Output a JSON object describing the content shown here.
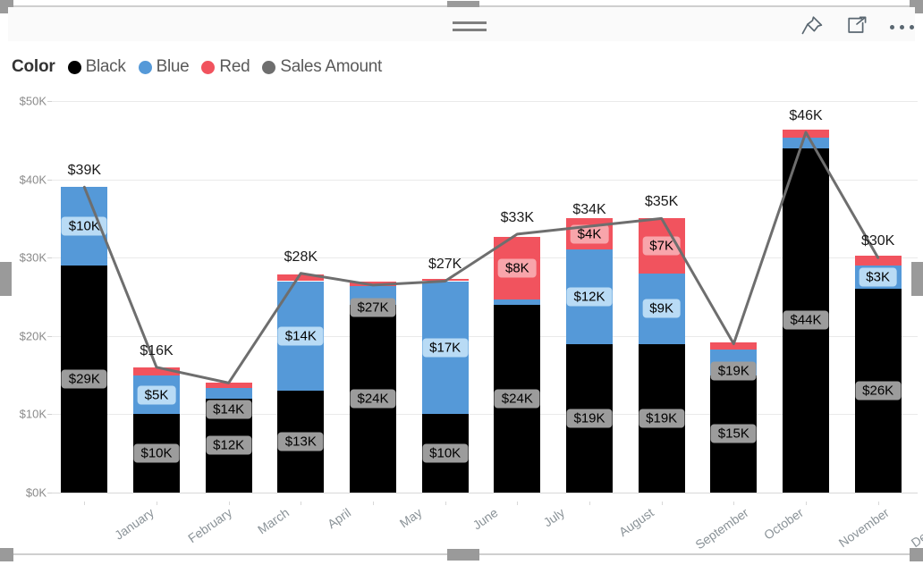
{
  "header": {
    "drag_handle_name": "drag-handle",
    "icons": [
      {
        "name": "pin-icon",
        "label": "Pin to dashboard"
      },
      {
        "name": "focus-icon",
        "label": "Focus mode"
      },
      {
        "name": "more-icon",
        "label": "More options"
      }
    ]
  },
  "legend": {
    "title": "Color",
    "items": [
      {
        "label": "Black",
        "color": "#000000"
      },
      {
        "label": "Blue",
        "color": "#5599d8"
      },
      {
        "label": "Red",
        "color": "#f1535e"
      },
      {
        "label": "Sales Amount",
        "color": "#6e6e6e"
      }
    ]
  },
  "chart_data": {
    "type": "bar",
    "subtype": "stacked-column-with-line",
    "title": "",
    "xlabel": "",
    "ylabel": "",
    "ylim": [
      0,
      50000
    ],
    "grid": true,
    "legend_position": "top",
    "y_ticks": [
      "$0K",
      "$10K",
      "$20K",
      "$30K",
      "$40K",
      "$50K"
    ],
    "y_tick_values": [
      0,
      10000,
      20000,
      30000,
      40000,
      50000
    ],
    "categories": [
      "January",
      "February",
      "March",
      "April",
      "May",
      "June",
      "July",
      "August",
      "September",
      "October",
      "November",
      "December"
    ],
    "series": [
      {
        "name": "Black",
        "color": "#000000",
        "values": [
          29000,
          10000,
          12000,
          13000,
          24000,
          10000,
          24000,
          19000,
          19000,
          15000,
          44000,
          26000
        ],
        "labels": [
          "$29K",
          "$10K",
          "$12K",
          "$13K",
          "$24K",
          "$10K",
          "$24K",
          "$19K",
          "$19K",
          "$15K",
          "$44K",
          "$26K"
        ]
      },
      {
        "name": "Blue",
        "color": "#5599d8",
        "values": [
          10000,
          5000,
          1400,
          14000,
          2400,
          17000,
          700,
          12000,
          9000,
          3300,
          1300,
          3000
        ],
        "labels": [
          "$10K",
          "$5K",
          "",
          "$14K",
          "",
          "$17K",
          "",
          "$12K",
          "$9K",
          "",
          "",
          "$3K"
        ]
      },
      {
        "name": "Red",
        "color": "#f1535e",
        "values": [
          0,
          1000,
          700,
          900,
          600,
          300,
          8000,
          4000,
          7000,
          900,
          1100,
          1200
        ],
        "labels": [
          "",
          "",
          "",
          "",
          "",
          "",
          "$8K",
          "$4K",
          "$7K",
          "",
          "",
          ""
        ]
      }
    ],
    "totals": [
      39000,
      16000,
      14000,
      28000,
      27000,
      27000,
      33000,
      34000,
      35000,
      19000,
      46000,
      30000
    ],
    "total_labels": [
      "$39K",
      "$16K",
      "$14K",
      "$28K",
      "$27K",
      "$27K",
      "$33K",
      "$34K",
      "$35K",
      "$19K",
      "$46K",
      "$30K"
    ],
    "total_label_placement": [
      "above",
      "above",
      "inside",
      "above",
      "inside",
      "above",
      "above",
      "above",
      "above",
      "inside",
      "above",
      "above"
    ],
    "line_series": {
      "name": "Sales Amount",
      "color": "#6e6e6e",
      "values": [
        39000,
        16000,
        14000,
        28000,
        26500,
        27000,
        33000,
        34000,
        35000,
        19000,
        46000,
        30000
      ]
    }
  }
}
